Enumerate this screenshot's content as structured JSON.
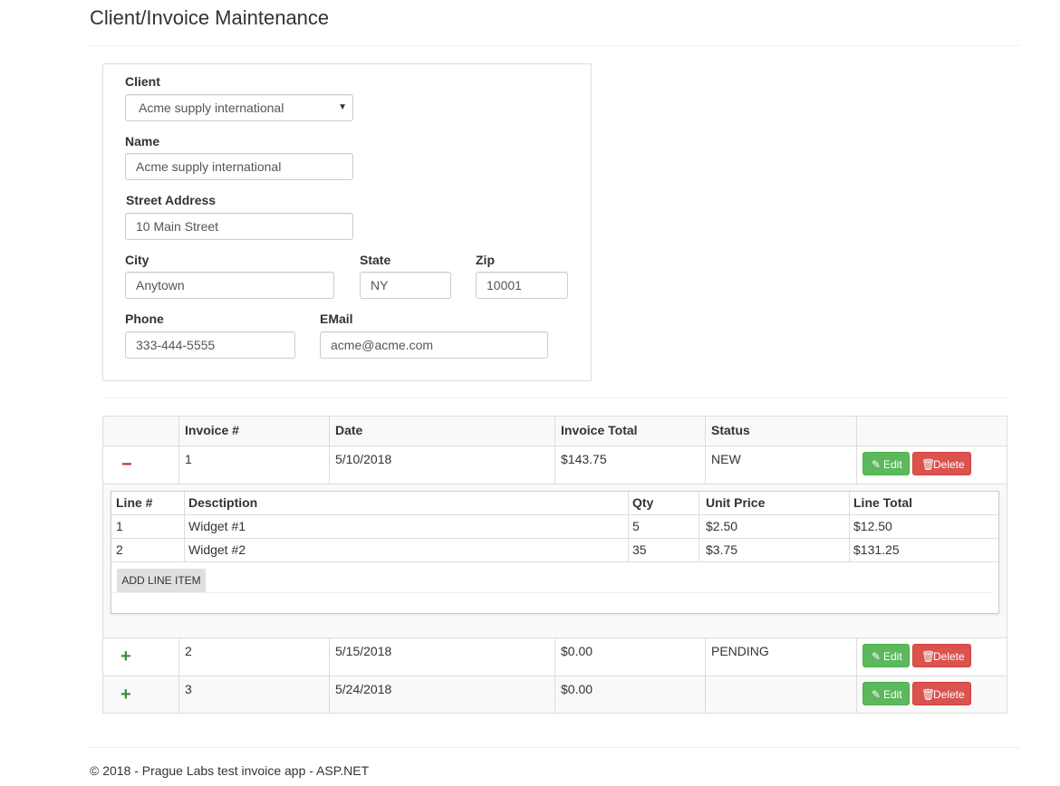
{
  "page": {
    "title": "Client/Invoice Maintenance"
  },
  "client_form": {
    "client": {
      "label": "Client",
      "value": "Acme supply international"
    },
    "name": {
      "label": "Name",
      "value": "Acme supply international"
    },
    "street": {
      "label": "Street Address",
      "value": "10 Main Street"
    },
    "city": {
      "label": "City",
      "value": "Anytown"
    },
    "state": {
      "label": "State",
      "value": "NY"
    },
    "zip": {
      "label": "Zip",
      "value": "10001"
    },
    "phone": {
      "label": "Phone",
      "value": "333-444-5555"
    },
    "email": {
      "label": "EMail",
      "value": "acme@acme.com"
    }
  },
  "invoices": {
    "headers": [
      "",
      "Invoice #",
      "Date",
      "Invoice Total",
      "Status",
      ""
    ],
    "edit_label": "Edit",
    "delete_label": "Delete",
    "rows": [
      {
        "toggle": "−",
        "number": "1",
        "date": "5/10/2018",
        "total": "$143.75",
        "status": "NEW"
      },
      {
        "toggle": "+",
        "number": "2",
        "date": "5/15/2018",
        "total": "$0.00",
        "status": "PENDING"
      },
      {
        "toggle": "+",
        "number": "3",
        "date": "5/24/2018",
        "total": "$0.00",
        "status": ""
      }
    ]
  },
  "line_items": {
    "headers": [
      "Line #",
      "Desctiption",
      "Qty",
      "Unit Price",
      "Line Total"
    ],
    "rows": [
      {
        "line": "1",
        "description": "Widget #1",
        "qty": "5",
        "unit_price": "$2.50",
        "line_total": "$12.50"
      },
      {
        "line": "2",
        "description": "Widget #2",
        "qty": "35",
        "unit_price": "$3.75",
        "line_total": "$131.25"
      }
    ],
    "add_label": "ADD LINE ITEM"
  },
  "footer": {
    "text": "© 2018 - Prague Labs test invoice app - ASP.NET"
  },
  "colors": {
    "edit": "#5cb85c",
    "delete": "#d9534f",
    "collapse": "#c9302c",
    "expand": "#3c8d3c"
  },
  "icons": {
    "collapse": "minus-icon",
    "expand": "plus-icon",
    "edit": "pencil-icon",
    "delete": "trash-icon",
    "select": "caret-down-icon"
  }
}
